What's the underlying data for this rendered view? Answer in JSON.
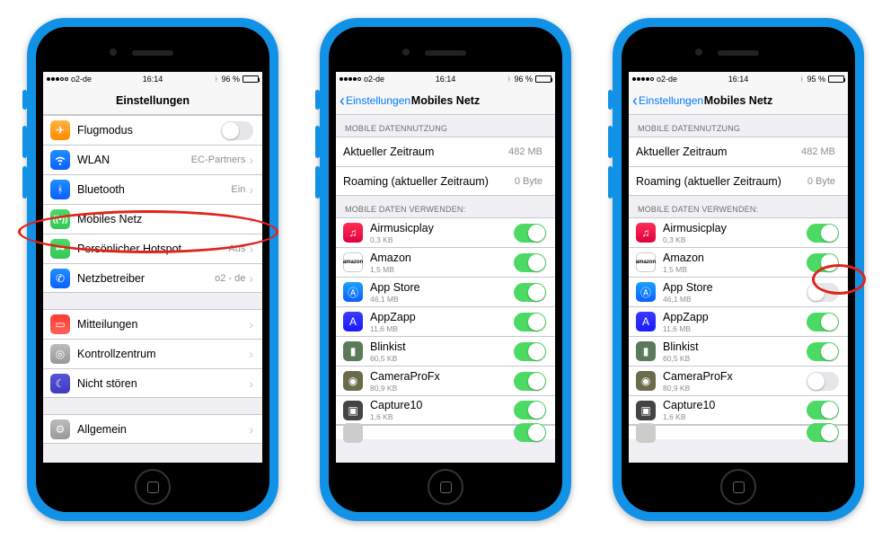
{
  "statusbar": {
    "carrier": "o2-de",
    "time": "16:14",
    "battery_p1": "96 %",
    "battery_p3": "95 %"
  },
  "phone1": {
    "nav_title": "Einstellungen",
    "rows": {
      "airplane": "Flugmodus",
      "wifi": "WLAN",
      "wifi_val": "EC-Partners",
      "bluetooth": "Bluetooth",
      "bt_val": "Ein",
      "cellular": "Mobiles Netz",
      "hotspot": "Persönlicher Hotspot",
      "hotspot_val": "Aus",
      "carrier": "Netzbetreiber",
      "carrier_val": "o2 - de",
      "notifications": "Mitteilungen",
      "control_center": "Kontrollzentrum",
      "dnd": "Nicht stören",
      "general": "Allgemein"
    }
  },
  "mobile": {
    "back_label": "Einstellungen",
    "title": "Mobiles Netz",
    "section_usage": "MOBILE DATENNUTZUNG",
    "current_period": "Aktueller Zeitraum",
    "current_period_val": "482 MB",
    "roaming": "Roaming (aktueller Zeitraum)",
    "roaming_val": "0 Byte",
    "section_apps": "MOBILE DATEN VERWENDEN:",
    "apps": [
      {
        "name": "Airmusicplay",
        "size": "0,3 KB",
        "icon": "ic-airmusic",
        "on": true
      },
      {
        "name": "Amazon",
        "size": "1,5 MB",
        "icon": "ic-amazon",
        "on": true
      },
      {
        "name": "App Store",
        "size": "46,1 MB",
        "icon": "ic-appstore",
        "on": true
      },
      {
        "name": "AppZapp",
        "size": "11,6 MB",
        "icon": "ic-appzapp",
        "on": true
      },
      {
        "name": "Blinkist",
        "size": "60,5 KB",
        "icon": "ic-blinkist",
        "on": true
      },
      {
        "name": "CameraProFx",
        "size": "80,9 KB",
        "icon": "ic-camerafx",
        "on": true
      },
      {
        "name": "Capture10",
        "size": "1,6 KB",
        "icon": "ic-capture10",
        "on": true
      }
    ],
    "apps_p3": [
      {
        "name": "Airmusicplay",
        "size": "0,3 KB",
        "icon": "ic-airmusic",
        "on": true
      },
      {
        "name": "Amazon",
        "size": "1,5 MB",
        "icon": "ic-amazon",
        "on": true
      },
      {
        "name": "App Store",
        "size": "46,1 MB",
        "icon": "ic-appstore",
        "on": false
      },
      {
        "name": "AppZapp",
        "size": "11,6 MB",
        "icon": "ic-appzapp",
        "on": true
      },
      {
        "name": "Blinkist",
        "size": "60,5 KB",
        "icon": "ic-blinkist",
        "on": true
      },
      {
        "name": "CameraProFx",
        "size": "80,9 KB",
        "icon": "ic-camerafx",
        "on": false
      },
      {
        "name": "Capture10",
        "size": "1,6 KB",
        "icon": "ic-capture10",
        "on": true
      }
    ]
  }
}
